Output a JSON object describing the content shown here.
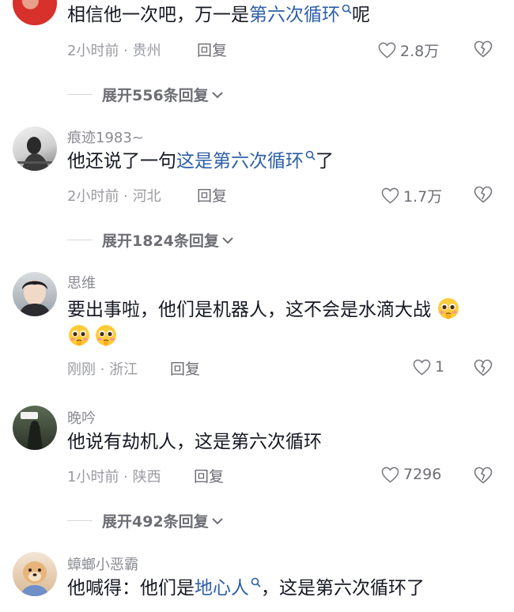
{
  "comments": [
    {
      "text_before": "相信他一次吧，万一是",
      "keyword": "第六次循环",
      "text_after": "呢",
      "time_loc": "2小时前 · 贵州",
      "reply_label": "回复",
      "likes": "2.8万",
      "expand_label": "展开556条回复"
    },
    {
      "username": "痕迹1983~",
      "text_before": "他还说了一句",
      "keyword": "这是第六次循环",
      "text_after": "了",
      "time_loc": "2小时前 · 河北",
      "reply_label": "回复",
      "likes": "1.7万",
      "expand_label": "展开1824条回复"
    },
    {
      "username": "思维",
      "text": "要出事啦，他们是机器人，这不会是水滴大战",
      "time_loc": "刚刚 · 浙江",
      "reply_label": "回复",
      "likes": "1"
    },
    {
      "username": "晚吟",
      "text": "他说有劫机人，这是第六次循环",
      "time_loc": "1小时前 · 陕西",
      "reply_label": "回复",
      "likes": "7296",
      "expand_label": "展开492条回复"
    },
    {
      "username": "蟑螂小恶霸",
      "text_before": "他喊得：他们是",
      "keyword": "地心人",
      "text_after": "，这是第六次循环了"
    }
  ],
  "icons": {
    "like": "heart-outline-icon",
    "dislike": "broken-heart-icon",
    "expand": "chevron-down-icon",
    "search": "search-icon",
    "emoji": "pleading-face-emoji"
  },
  "colors": {
    "keyword": "#2d5fa8",
    "meta": "#9a9ba1",
    "text": "#161823"
  }
}
